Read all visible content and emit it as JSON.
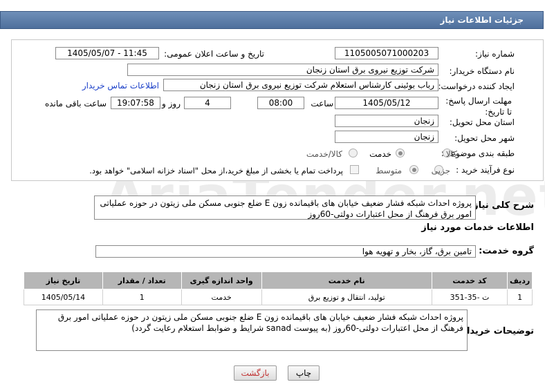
{
  "header": {
    "title": "جزئیات اطلاعات نیاز"
  },
  "fields": {
    "need_number_label": "شماره نیاز:",
    "need_number": "1105005071000203",
    "announce_label": "تاریخ و ساعت اعلان عمومی:",
    "announce_value": "1405/05/07 - 11:45",
    "buyer_org_label": "نام دستگاه خریدار:",
    "buyer_org": "شرکت توزیع نیروی برق استان زنجان",
    "creator_label": "ایجاد کننده درخواست:",
    "creator": "رباب بوئینی کارشناس استعلام شرکت توزیع نیروی برق استان زنجان",
    "contact_link": "اطلاعات تماس خریدار",
    "deadline_label": "مهلت ارسال پاسخ: تا تاریخ:",
    "deadline_date": "1405/05/12",
    "time_label": "ساعت",
    "deadline_time": "08:00",
    "days_value": "4",
    "days_label": "روز و",
    "remaining_time": "19:07:58",
    "remaining_label": "ساعت باقی مانده",
    "province_label": "استان محل تحویل:",
    "province": "زنجان",
    "city_label": "شهر محل تحویل:",
    "city": "زنجان",
    "category_label": "طبقه بندی موضوعی:",
    "category_options": [
      "کالا",
      "خدمت",
      "کالا/خدمت"
    ],
    "process_label": "نوع فرآیند خرید :",
    "process_options": [
      "جزیی",
      "متوسط"
    ],
    "payment_note": "پرداخت تمام یا بخشی از مبلغ خرید،از محل \"اسناد خزانه اسلامی\" خواهد بود."
  },
  "summary": {
    "label": "شرح کلی نیاز:",
    "text": "پروژه احداث شبکه فشار ضعیف خیابان های باقیمانده زون E ضلع جنوبی مسکن ملی زیتون در حوزه عملیاتی امور برق فرهنگ از محل اعتبارات دولتی-60روز"
  },
  "services": {
    "section_title": "اطلاعات خدمات مورد نیاز",
    "group_label": "گروه خدمت:",
    "group_value": "تامین برق، گاز، بخار و تهویه هوا",
    "columns": [
      "ردیف",
      "کد خدمت",
      "نام خدمت",
      "واحد اندازه گیری",
      "تعداد / مقدار",
      "تاریخ نیاز"
    ],
    "rows": [
      [
        "1",
        "ت -35-351",
        "تولید، انتقال و توزیع برق",
        "خدمت",
        "1",
        "1405/05/14"
      ]
    ]
  },
  "buyer_notes": {
    "label": "توضیحات خریدار:",
    "text": "پروژه احداث شبکه فشار ضعیف خیابان های باقیمانده زون E ضلع جنوبی مسکن ملی زیتون در حوزه عملیاتی امور برق فرهنگ از محل اعتبارات دولتی-60روز (به پیوست sanad شرایط و ضوابط استعلام  رعایت گردد)"
  },
  "buttons": {
    "print": "چاپ",
    "back": "بازگشت"
  },
  "watermark": "AriaTender.net"
}
